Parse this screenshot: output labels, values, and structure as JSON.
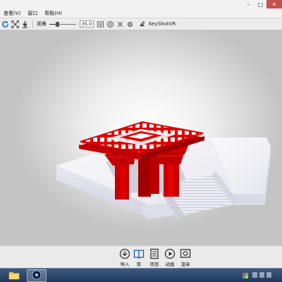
{
  "menubar": {
    "items": [
      "查看(V)",
      "窗口",
      "帮助(H)"
    ]
  },
  "toolbar": {
    "fov_label": "视角",
    "fov_value": "35.0",
    "fov_level": 0.3,
    "vr_label": "KeyShotVR",
    "icons": [
      "refresh-icon",
      "fit-view-icon",
      "import-arrow-icon",
      "render-region-icon",
      "turntable-icon",
      "move-icon",
      "settings-icon",
      "keyshotvr-icon"
    ]
  },
  "ribbon": {
    "buttons": [
      {
        "label": "导入",
        "icon": "import-icon"
      },
      {
        "label": "库",
        "icon": "library-icon"
      },
      {
        "label": "项目",
        "icon": "project-icon"
      },
      {
        "label": "动画",
        "icon": "animation-icon"
      },
      {
        "label": "渲染",
        "icon": "render-icon"
      }
    ]
  },
  "colors": {
    "model_red": "#e00000",
    "base_white": "#f5f5f8",
    "background": "#e8e8e8"
  }
}
